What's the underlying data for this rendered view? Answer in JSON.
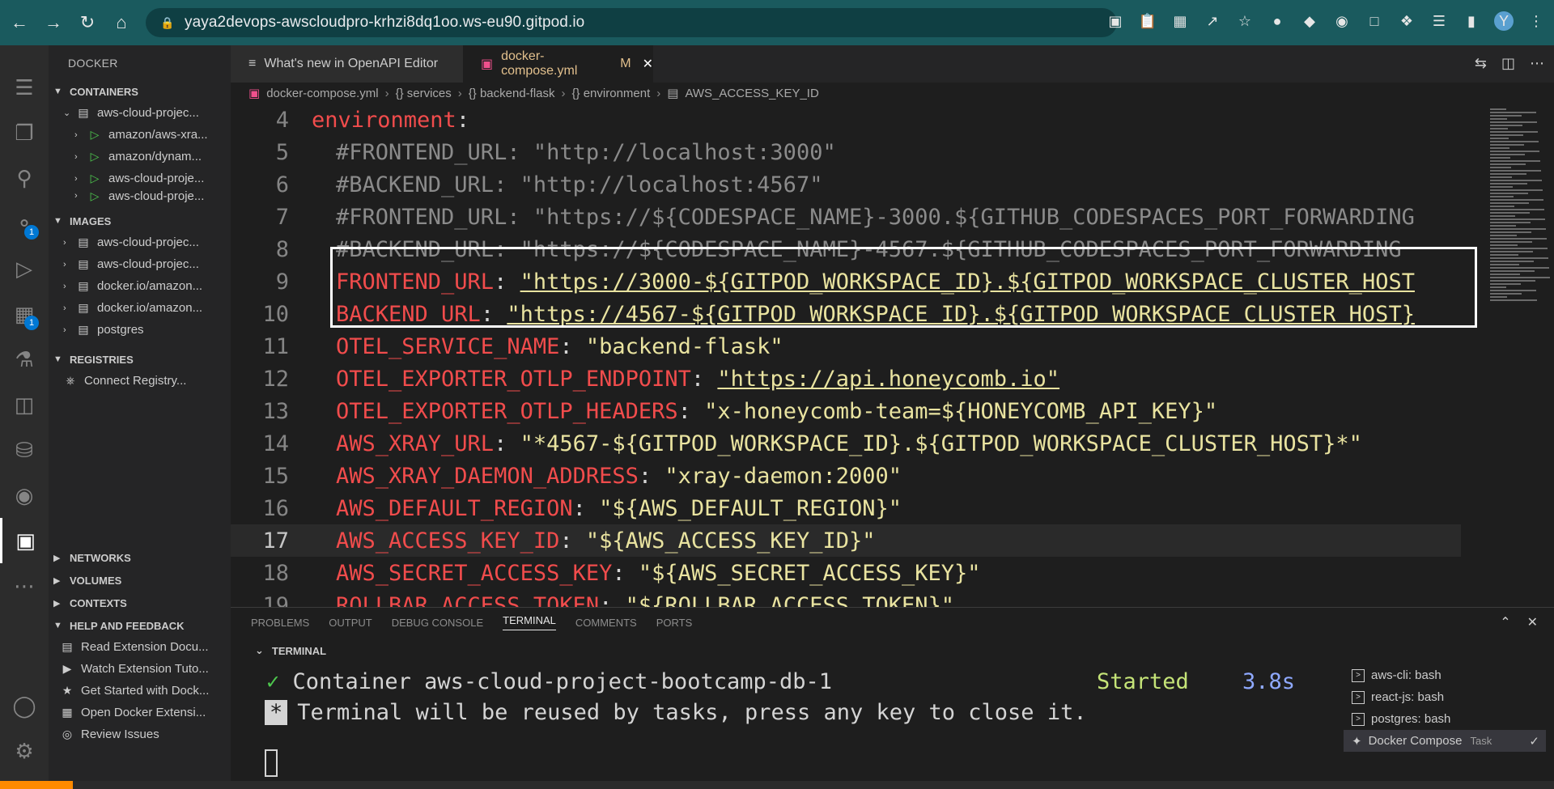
{
  "browser": {
    "url": "yaya2devops-awscloudpro-krhzi8dq1oo.ws-eu90.gitpod.io",
    "avatar_initial": "Y"
  },
  "activity_bar": {
    "badges": {
      "source_control": "1",
      "extensions": "1"
    }
  },
  "sidebar": {
    "title": "DOCKER",
    "containers_header": "CONTAINERS",
    "containers_group": "aws-cloud-projec...",
    "containers": [
      "amazon/aws-xra...",
      "amazon/dynam...",
      "aws-cloud-proje...",
      "aws-cloud-proje..."
    ],
    "images_header": "IMAGES",
    "images": [
      "aws-cloud-projec...",
      "aws-cloud-projec...",
      "docker.io/amazon...",
      "docker.io/amazon...",
      "postgres"
    ],
    "registries_header": "REGISTRIES",
    "connect_registry": "Connect Registry...",
    "networks_header": "NETWORKS",
    "volumes_header": "VOLUMES",
    "contexts_header": "CONTEXTS",
    "help_header": "HELP AND FEEDBACK",
    "help_items": [
      "Read Extension Docu...",
      "Watch Extension Tuto...",
      "Get Started with Dock...",
      "Open Docker Extensi...",
      "Review Issues"
    ]
  },
  "tabs": [
    {
      "label": "What's new in OpenAPI Editor"
    },
    {
      "label": "docker-compose.yml",
      "modified": "M"
    }
  ],
  "breadcrumb": [
    "docker-compose.yml",
    "{} services",
    "{} backend-flask",
    "{} environment",
    "AWS_ACCESS_KEY_ID"
  ],
  "editor": {
    "lines": [
      {
        "num": "4",
        "key": "environment",
        "punc": ":",
        "value": "",
        "kind": "key"
      },
      {
        "num": "5",
        "text": "#FRONTEND_URL: \"http://localhost:3000\"",
        "kind": "comment"
      },
      {
        "num": "6",
        "text": "#BACKEND_URL: \"http://localhost:4567\"",
        "kind": "comment"
      },
      {
        "num": "7",
        "text": "#FRONTEND_URL: \"https://${CODESPACE_NAME}-3000.${GITHUB_CODESPACES_PORT_FORWARDING",
        "kind": "comment"
      },
      {
        "num": "8",
        "text": "#BACKEND_URL: \"https://${CODESPACE_NAME}-4567.${GITHUB_CODESPACES_PORT_FORWARDING",
        "kind": "comment"
      },
      {
        "num": "9",
        "key": "FRONTEND_URL",
        "punc": ": ",
        "value": "\"https://3000-${GITPOD_WORKSPACE_ID}.${GITPOD_WORKSPACE_CLUSTER_HOST",
        "kind": "kv"
      },
      {
        "num": "10",
        "key": "BACKEND_URL",
        "punc": ": ",
        "value": "\"https://4567-${GITPOD_WORKSPACE_ID}.${GITPOD_WORKSPACE_CLUSTER_HOST}",
        "kind": "kv"
      },
      {
        "num": "11",
        "key": "OTEL_SERVICE_NAME",
        "punc": ": ",
        "value": "\"backend-flask\"",
        "kind": "kv"
      },
      {
        "num": "12",
        "key": "OTEL_EXPORTER_OTLP_ENDPOINT",
        "punc": ": ",
        "value": "\"https://api.honeycomb.io\"",
        "kind": "kv"
      },
      {
        "num": "13",
        "key": "OTEL_EXPORTER_OTLP_HEADERS",
        "punc": ": ",
        "value": "\"x-honeycomb-team=${HONEYCOMB_API_KEY}\"",
        "kind": "kv"
      },
      {
        "num": "14",
        "key": "AWS_XRAY_URL",
        "punc": ": ",
        "value": "\"*4567-${GITPOD_WORKSPACE_ID}.${GITPOD_WORKSPACE_CLUSTER_HOST}*\"",
        "kind": "kv"
      },
      {
        "num": "15",
        "key": "AWS_XRAY_DAEMON_ADDRESS",
        "punc": ": ",
        "value": "\"xray-daemon:2000\"",
        "kind": "kv"
      },
      {
        "num": "16",
        "key": "AWS_DEFAULT_REGION",
        "punc": ": ",
        "value": "\"${AWS_DEFAULT_REGION}\"",
        "kind": "kv"
      },
      {
        "num": "17",
        "key": "AWS_ACCESS_KEY_ID",
        "punc": ": ",
        "value": "\"${AWS_ACCESS_KEY_ID}\"",
        "kind": "kv",
        "current": true
      },
      {
        "num": "18",
        "key": "AWS_SECRET_ACCESS_KEY",
        "punc": ": ",
        "value": "\"${AWS_SECRET_ACCESS_KEY}\"",
        "kind": "kv"
      },
      {
        "num": "19",
        "key": "ROLLBAR_ACCESS_TOKEN",
        "punc": ": ",
        "value": "\"${ROLLBAR_ACCESS_TOKEN}\"",
        "kind": "kv"
      }
    ]
  },
  "panel": {
    "tabs": [
      "PROBLEMS",
      "OUTPUT",
      "DEBUG CONSOLE",
      "TERMINAL",
      "COMMENTS",
      "PORTS"
    ],
    "active_tab": "TERMINAL",
    "terminal_header": "TERMINAL",
    "terminal_lines": {
      "container": "Container aws-cloud-project-bootcamp-db-1",
      "status": "Started",
      "duration": "3.8s",
      "reuse_marker": "*",
      "reuse": "Terminal will be reused by tasks, press any key to close it."
    },
    "terminals": [
      {
        "label": "aws-cli: bash"
      },
      {
        "label": "react-js: bash"
      },
      {
        "label": "postgres: bash"
      },
      {
        "label": "Docker Compose",
        "tag": "Task",
        "active": true
      }
    ]
  },
  "colors": {
    "browser_bar": "#1a5a5e",
    "highlight_border": "#ffffff",
    "yaml_key": "#f14c4c",
    "yaml_string": "#e9e3a0",
    "status_gitpod": "#ff8a00"
  }
}
